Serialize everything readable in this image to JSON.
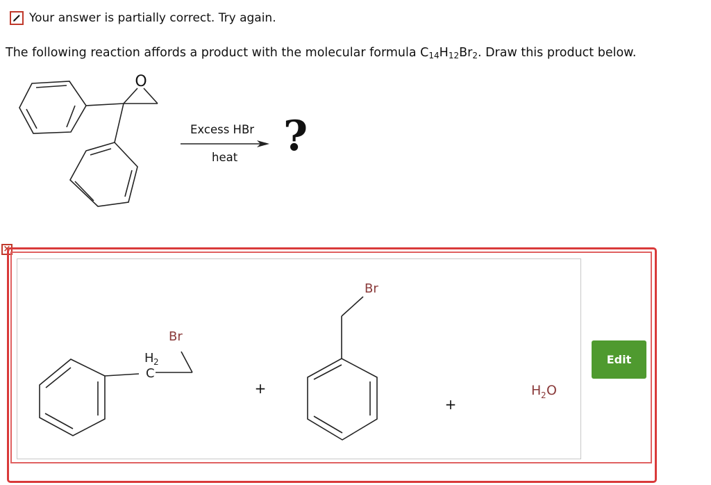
{
  "feedback": {
    "message": "Your answer is partially correct.  Try again.",
    "icon": "pencil-icon",
    "color": "#c0392b"
  },
  "question": {
    "text_before": "The following reaction affords a product with the molecular formula ",
    "formula_parts": [
      "C",
      "14",
      "H",
      "12",
      "Br",
      "2"
    ],
    "text_after": ". Draw this product below."
  },
  "reaction": {
    "reagent": "Excess HBr",
    "condition": "heat",
    "unknown_product": "?",
    "reactant_atom_label": "O"
  },
  "answer": {
    "molecule1": {
      "br_label": "Br",
      "ch2_h": "H",
      "ch2_sub": "2",
      "ch2_c": "C"
    },
    "plus1": "+",
    "molecule2": {
      "br_label": "Br"
    },
    "plus2": "+",
    "water": {
      "h": "H",
      "sub": "2",
      "o": "O"
    },
    "label_color": "#8a3a3a",
    "close_label": "×",
    "edit_label": "Edit",
    "edit_color": "#4f9a2f"
  }
}
